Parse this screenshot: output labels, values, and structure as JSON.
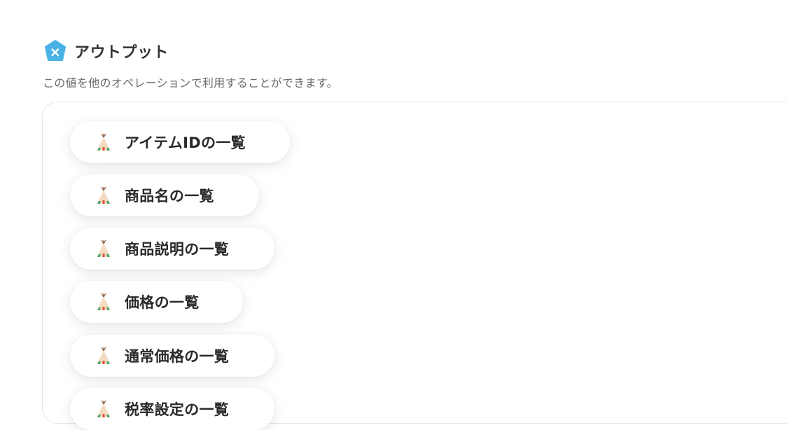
{
  "header": {
    "title": "アウトプット",
    "icon": "yoom-x-icon",
    "icon_color": "#4AB3E6"
  },
  "subtitle": "この値を他のオペレーションで利用することができます。",
  "outputs": {
    "item_icon": "teepee-icon",
    "items": [
      {
        "label": "アイテムIDの一覧"
      },
      {
        "label": "商品名の一覧"
      },
      {
        "label": "商品説明の一覧"
      },
      {
        "label": "価格の一覧"
      },
      {
        "label": "通常価格の一覧"
      },
      {
        "label": "税率設定の一覧"
      }
    ]
  }
}
